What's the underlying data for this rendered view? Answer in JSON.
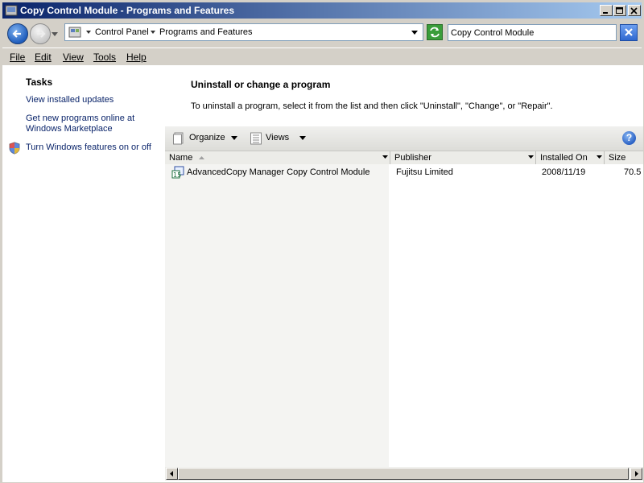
{
  "window": {
    "title": "Copy Control Module - Programs and Features"
  },
  "address": {
    "crumbs": [
      "Control Panel",
      "Programs and Features"
    ],
    "search_value": "Copy Control Module"
  },
  "menu": [
    "File",
    "Edit",
    "View",
    "Tools",
    "Help"
  ],
  "tasks": {
    "title": "Tasks",
    "links": [
      "View installed updates",
      "Get new programs online at",
      "Windows Marketplace",
      "Turn Windows features on or off"
    ]
  },
  "main": {
    "title": "Uninstall or change a program",
    "description": "To uninstall a program, select it from the list and then click \"Uninstall\", \"Change\", or \"Repair\"."
  },
  "toolbar": {
    "organize": "Organize",
    "views": "Views",
    "help": "?"
  },
  "columns": [
    "Name",
    "Publisher",
    "Installed On",
    "Size"
  ],
  "rows": [
    {
      "name": "AdvancedCopy Manager Copy Control Module",
      "publisher": "Fujitsu Limited",
      "installed": "2008/11/19",
      "size": "70.5"
    }
  ]
}
